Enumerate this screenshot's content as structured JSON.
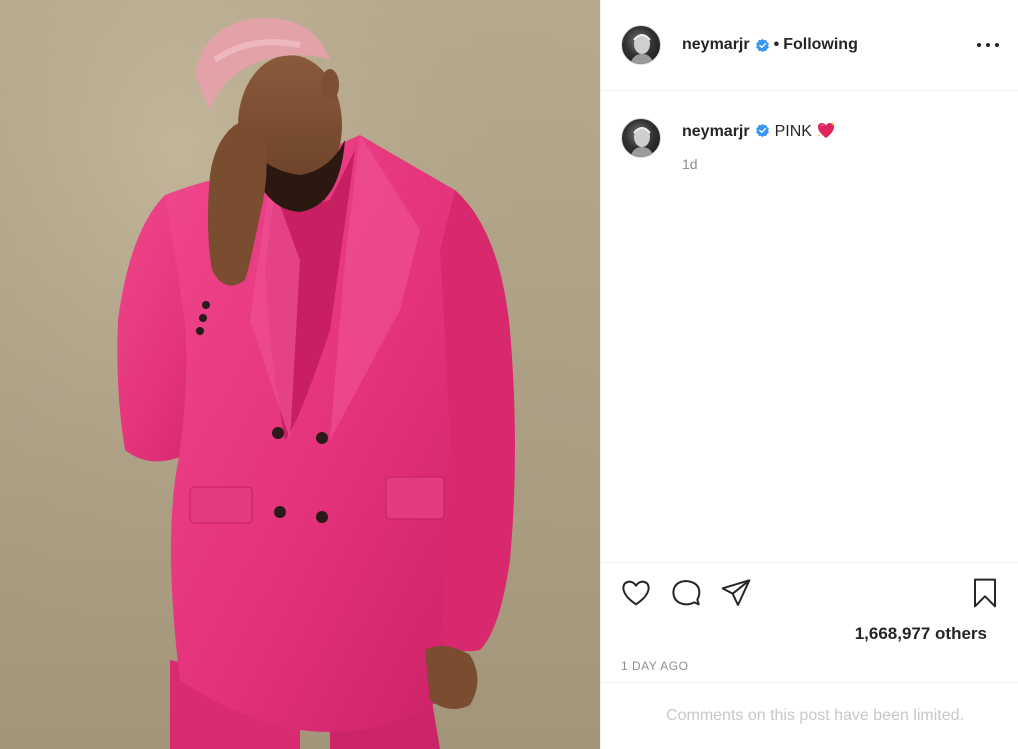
{
  "post": {
    "username": "neymarjr",
    "follow_separator": "•",
    "follow_status": "Following",
    "caption_text": "PINK",
    "caption_emoji": "sparkling-heart",
    "caption_time": "1d",
    "likes_text": "1,668,977 others",
    "posted_ago": "1 DAY AGO",
    "comments_notice": "Comments on this post have been limited."
  },
  "icons": {
    "verified": "verified-badge-icon",
    "more": "more-options-icon",
    "like": "heart-icon",
    "comment": "comment-icon",
    "share": "share-icon",
    "save": "bookmark-icon"
  },
  "colors": {
    "verified_blue": "#3897f0",
    "suit_pink": "#e8377e",
    "text_primary": "#262626",
    "text_muted": "#8e8e8e",
    "text_placeholder": "#c7c7c7"
  }
}
